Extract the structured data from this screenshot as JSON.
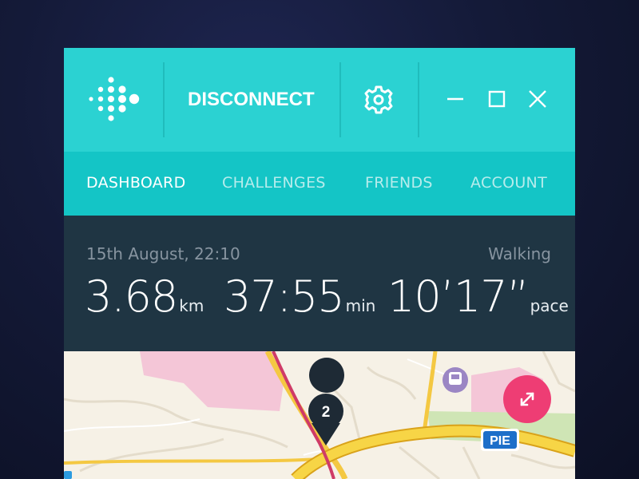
{
  "app": {
    "header": {
      "logo_icon": "fitbit-dots-logo",
      "disconnect_label": "DISCONNECT",
      "settings_icon": "gear-icon",
      "window_controls": [
        "minimize-icon",
        "maximize-icon",
        "close-icon"
      ]
    },
    "nav": {
      "tabs": [
        {
          "label": "DASHBOARD",
          "active": true
        },
        {
          "label": "CHALLENGES",
          "active": false
        },
        {
          "label": "FRIENDS",
          "active": false
        },
        {
          "label": "ACCOUNT",
          "active": false
        }
      ]
    },
    "activity": {
      "datetime": "15th August, 22:10",
      "type": "Walking",
      "distance": {
        "value": "3.68",
        "unit": "km"
      },
      "duration": {
        "value": "37:55",
        "unit": "min"
      },
      "pace": {
        "value": "10’17”",
        "unit": "pace"
      }
    },
    "map": {
      "marker_label": "2",
      "highway_label": "PIE",
      "expand_icon": "expand-icon",
      "transit_icon": "train-station-icon"
    },
    "colors": {
      "header_bg": "#2bd2d2",
      "nav_bg": "#14c5c6",
      "stats_bg": "#1f3543",
      "expand_button": "#ee3d74"
    }
  }
}
